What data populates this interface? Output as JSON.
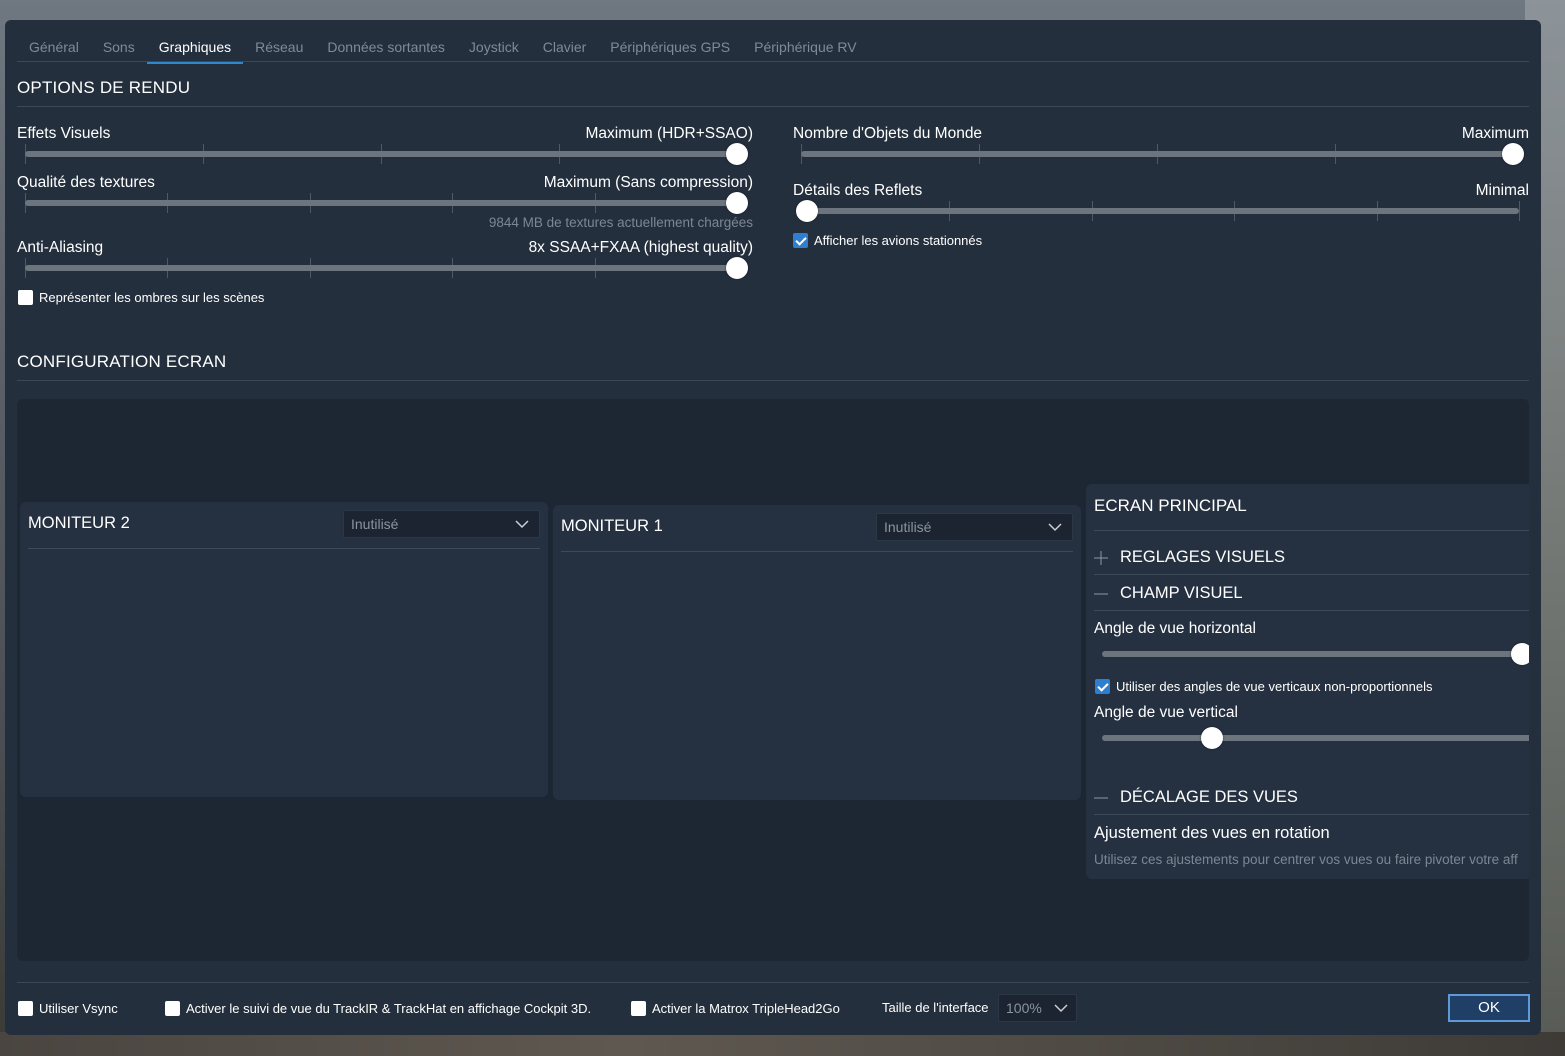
{
  "tabs": [
    {
      "label": "Général"
    },
    {
      "label": "Sons"
    },
    {
      "label": "Graphiques",
      "active": true
    },
    {
      "label": "Réseau"
    },
    {
      "label": "Données sortantes"
    },
    {
      "label": "Joystick"
    },
    {
      "label": "Clavier"
    },
    {
      "label": "Périphériques GPS"
    },
    {
      "label": "Périphérique  RV"
    }
  ],
  "rendering": {
    "title": "OPTIONS DE RENDU",
    "visual_effects": {
      "label": "Effets Visuels",
      "value": "Maximum (HDR+SSAO)",
      "level": 1.0
    },
    "texture_quality": {
      "label": "Qualité des textures",
      "value": "Maximum (Sans compression)",
      "level": 1.0,
      "hint": "9844 MB de textures actuellement chargées"
    },
    "anti_aliasing": {
      "label": "Anti-Aliasing",
      "value": "8x SSAA+FXAA (highest quality)",
      "level": 1.0
    },
    "shadows": {
      "label": "Représenter les ombres sur les scènes",
      "checked": false
    },
    "world_objects": {
      "label": "Nombre d'Objets du Monde",
      "value": "Maximum",
      "level": 1.0
    },
    "reflections": {
      "label": "Détails des Reflets",
      "value": "Minimal",
      "level": 0.0
    },
    "parked_aircraft": {
      "label": "Afficher les avions stationnés",
      "checked": true
    }
  },
  "screen": {
    "title": "CONFIGURATION ECRAN",
    "monitor2": {
      "title": "MONITEUR 2",
      "select": "Inutilisé"
    },
    "monitor1": {
      "title": "MONITEUR 1",
      "select": "Inutilisé"
    },
    "principal": {
      "title": "ECRAN PRINCIPAL",
      "visual_settings": "REGLAGES VISUELS",
      "field_of_view": "CHAMP VISUEL",
      "h_angle": {
        "label": "Angle de vue horizontal",
        "level": 1.0
      },
      "nonprop": {
        "label": "Utiliser des angles de vue verticaux non-proportionnels",
        "checked": true
      },
      "v_angle": {
        "label": "Angle de vue vertical",
        "level": 0.25
      },
      "view_offset": "DÉCALAGE DES VUES",
      "rotation_adjust": "Ajustement des vues en rotation",
      "rotation_hint": "Utilisez ces ajustements pour centrer vos vues ou faire pivoter votre aff"
    }
  },
  "footer": {
    "vsync": {
      "label": "Utiliser Vsync",
      "checked": false
    },
    "trackir": {
      "label": "Activer le suivi de vue du TrackIR & TrackHat en affichage Cockpit 3D.",
      "checked": false
    },
    "matrox": {
      "label": "Activer la Matrox TripleHead2Go",
      "checked": false
    },
    "ui_size_label": "Taille de l'interface",
    "ui_size_value": "100%",
    "ok_label": "OK"
  },
  "colors": {
    "accent": "#2e88d0",
    "panel": "#242f3d",
    "checkbox_checked": "#2f7fd0"
  }
}
